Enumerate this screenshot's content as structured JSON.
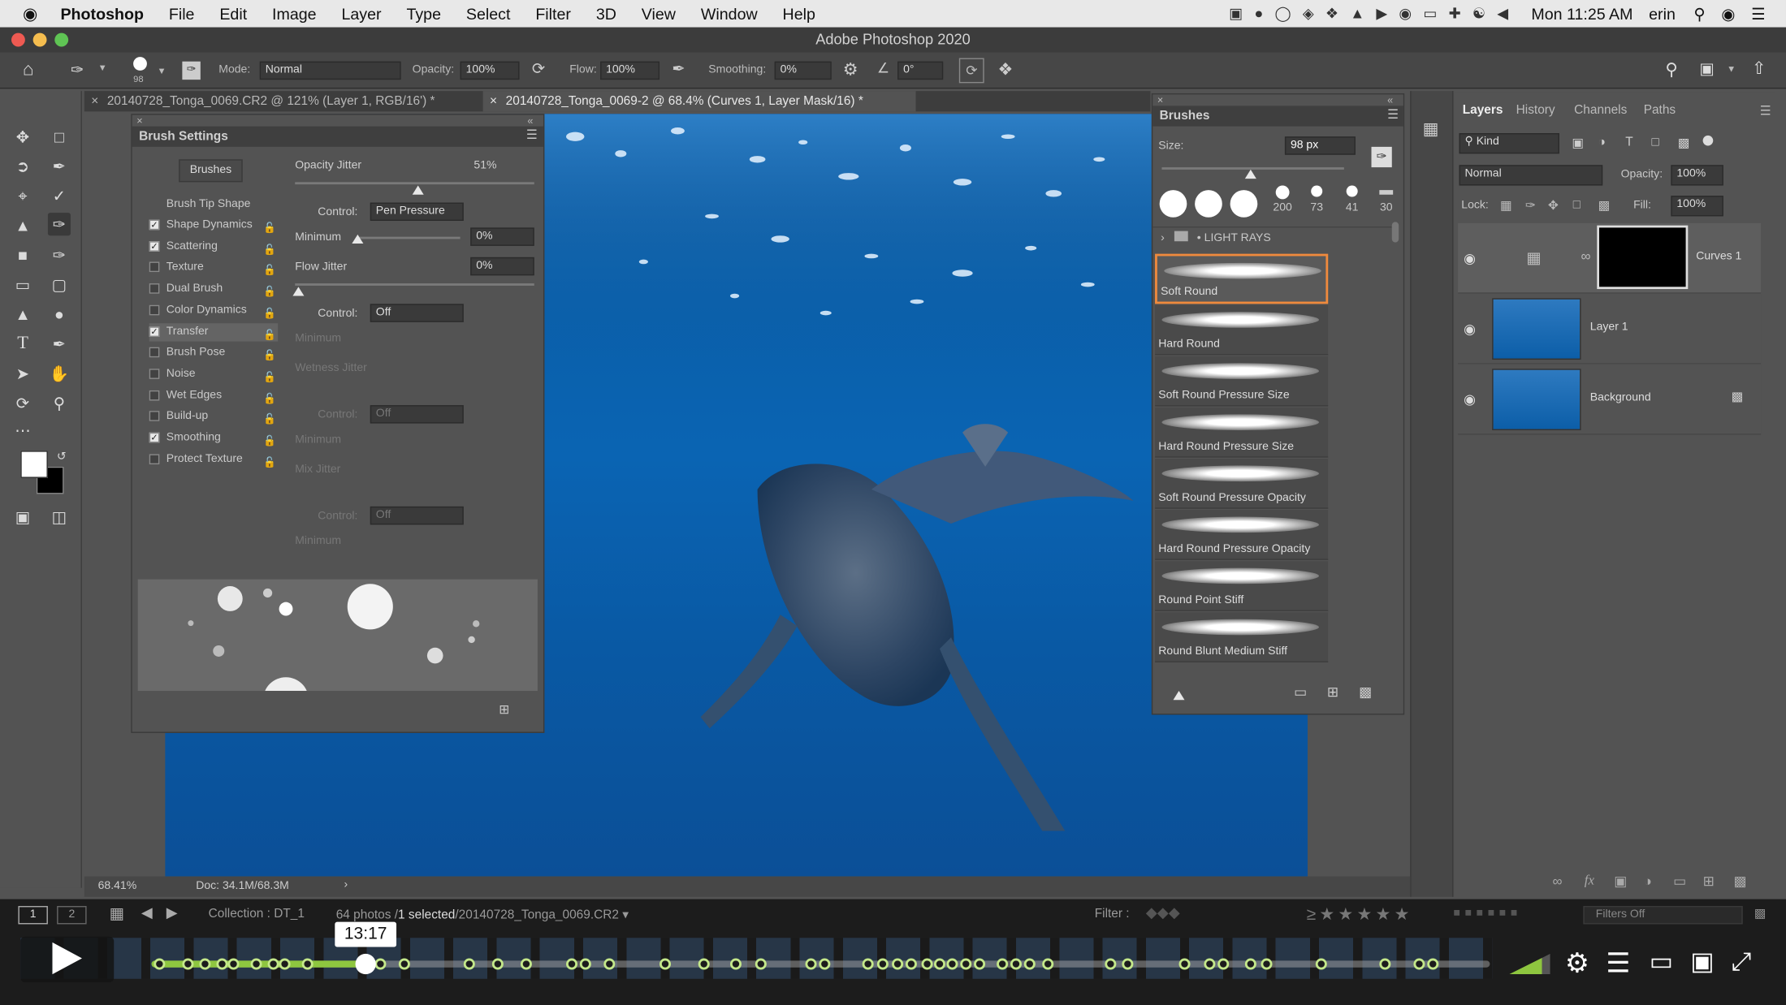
{
  "menubar": {
    "app": "Photoshop",
    "items": [
      "File",
      "Edit",
      "Image",
      "Layer",
      "Type",
      "Select",
      "Filter",
      "3D",
      "View",
      "Window",
      "Help"
    ],
    "clock": "Mon 11:25 AM",
    "user": "erin"
  },
  "window": {
    "title": "Adobe Photoshop 2020"
  },
  "options": {
    "brush_size": "98",
    "mode_label": "Mode:",
    "mode_value": "Normal",
    "opacity_label": "Opacity:",
    "opacity_value": "100%",
    "flow_label": "Flow:",
    "flow_value": "100%",
    "smoothing_label": "Smoothing:",
    "smoothing_value": "0%",
    "angle_value": "0°"
  },
  "tabs": [
    {
      "label": "20140728_Tonga_0069.CR2 @ 121% (Layer 1, RGB/16') *"
    },
    {
      "label": "20140728_Tonga_0069-2 @ 68.4% (Curves 1, Layer Mask/16) *"
    }
  ],
  "brush_settings": {
    "title": "Brush Settings",
    "brushes_button": "Brushes",
    "tip_shape": "Brush Tip Shape",
    "items": [
      {
        "label": "Shape Dynamics",
        "checked": true
      },
      {
        "label": "Scattering",
        "checked": true
      },
      {
        "label": "Texture",
        "checked": false
      },
      {
        "label": "Dual Brush",
        "checked": false
      },
      {
        "label": "Color Dynamics",
        "checked": false
      },
      {
        "label": "Transfer",
        "checked": true
      },
      {
        "label": "Brush Pose",
        "checked": false
      },
      {
        "label": "Noise",
        "checked": false
      },
      {
        "label": "Wet Edges",
        "checked": false
      },
      {
        "label": "Build-up",
        "checked": false
      },
      {
        "label": "Smoothing",
        "checked": true
      },
      {
        "label": "Protect Texture",
        "checked": false
      }
    ],
    "opacity_jitter_label": "Opacity Jitter",
    "opacity_jitter_value": "51%",
    "control_label": "Control:",
    "control_value": "Pen Pressure",
    "minimum_label": "Minimum",
    "minimum_value": "0%",
    "flow_jitter_label": "Flow Jitter",
    "flow_jitter_value": "0%",
    "control2_value": "Off",
    "minimum2_label": "Minimum",
    "wetness_label": "Wetness Jitter",
    "control3_value": "Off",
    "minimum3_label": "Minimum",
    "mix_label": "Mix Jitter",
    "control4_value": "Off",
    "minimum4_label": "Minimum"
  },
  "brushes_panel": {
    "title": "Brushes",
    "size_label": "Size:",
    "size_value": "98 px",
    "presets": [
      "200",
      "73",
      "41",
      "30"
    ],
    "group": "LIGHT RAYS",
    "brushes": [
      "Soft Round",
      "Hard Round",
      "Soft Round Pressure Size",
      "Hard Round Pressure Size",
      "Soft Round Pressure Opacity",
      "Hard Round Pressure Opacity",
      "Round Point Stiff",
      "Round Blunt Medium Stiff"
    ]
  },
  "layers_panel": {
    "tabs": [
      "Layers",
      "History",
      "Channels",
      "Paths"
    ],
    "kind": "Kind",
    "blend": "Normal",
    "opacity_label": "Opacity:",
    "opacity_value": "100%",
    "lock_label": "Lock:",
    "fill_label": "Fill:",
    "fill_value": "100%",
    "layers": [
      {
        "name": "Curves 1"
      },
      {
        "name": "Layer 1"
      },
      {
        "name": "Background"
      }
    ]
  },
  "status": {
    "zoom": "68.41%",
    "doc": "Doc: 34.1M/68.3M"
  },
  "filmstrip": {
    "page1": "1",
    "page2": "2",
    "collection": "Collection : DT_1",
    "count": "64 photos /",
    "selected": "1 selected",
    "filename": "/20140728_Tonga_0069.CR2",
    "filter_label": "Filter :",
    "filters_off": "Filters Off"
  },
  "video": {
    "time": "13:17",
    "progress": 0.16
  }
}
